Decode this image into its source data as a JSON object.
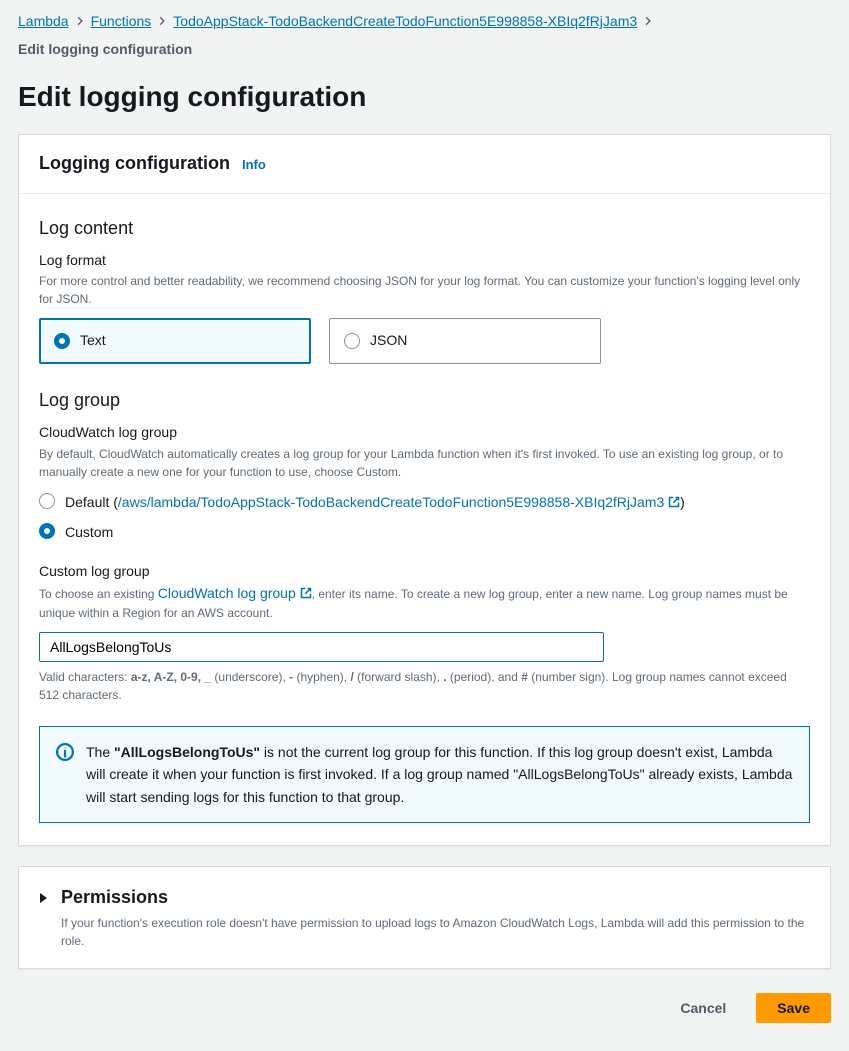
{
  "breadcrumb": {
    "items": [
      "Lambda",
      "Functions",
      "TodoAppStack-TodoBackendCreateTodoFunction5E998858-XBIq2fRjJam3"
    ],
    "current": "Edit logging configuration"
  },
  "page_title": "Edit logging configuration",
  "panel": {
    "title": "Logging configuration",
    "info_label": "Info"
  },
  "log_content": {
    "heading": "Log content",
    "format_label": "Log format",
    "format_desc": "For more control and better readability, we recommend choosing JSON for your log format. You can customize your function's logging level only for JSON.",
    "option_text": "Text",
    "option_json": "JSON",
    "selected": "text"
  },
  "log_group": {
    "heading": "Log group",
    "cw_label": "CloudWatch log group",
    "cw_desc": "By default, CloudWatch automatically creates a log group for your Lambda function when it's first invoked. To use an existing log group, or to manually create a new one for your function to use, choose Custom.",
    "default_prefix": "Default (",
    "default_link": "/aws/lambda/TodoAppStack-TodoBackendCreateTodoFunction5E998858-XBIq2fRjJam3",
    "default_suffix": ")",
    "custom_label": "Custom",
    "selected": "custom"
  },
  "custom_log_group": {
    "label": "Custom log group",
    "desc_pre": "To choose an existing ",
    "desc_link": "CloudWatch log group",
    "desc_post": ", enter its name. To create a new log group, enter a new name. Log group names must be unique within a Region for an AWS account.",
    "value": "AllLogsBelongToUs",
    "hint_pre": "Valid characters: ",
    "hint_bold": "a-z, A-Z, 0-9, _",
    "hint_mid1": " (underscore), ",
    "hint_b2": "-",
    "hint_mid2": " (hyphen), ",
    "hint_b3": "/",
    "hint_mid3": " (forward slash), ",
    "hint_b4": ".",
    "hint_mid4": " (period), and ",
    "hint_b5": "#",
    "hint_post": " (number sign). Log group names cannot exceed 512 characters."
  },
  "alert": {
    "pre": "The ",
    "name": "\"AllLogsBelongToUs\"",
    "post": " is not the current log group for this function. If this log group doesn't exist, Lambda will create it when your function is first invoked. If a log group named \"AllLogsBelongToUs\" already exists, Lambda will start sending logs for this function to that group."
  },
  "permissions": {
    "title": "Permissions",
    "desc": "If your function's execution role doesn't have permission to upload logs to Amazon CloudWatch Logs, Lambda will add this permission to the role."
  },
  "footer": {
    "cancel": "Cancel",
    "save": "Save"
  }
}
